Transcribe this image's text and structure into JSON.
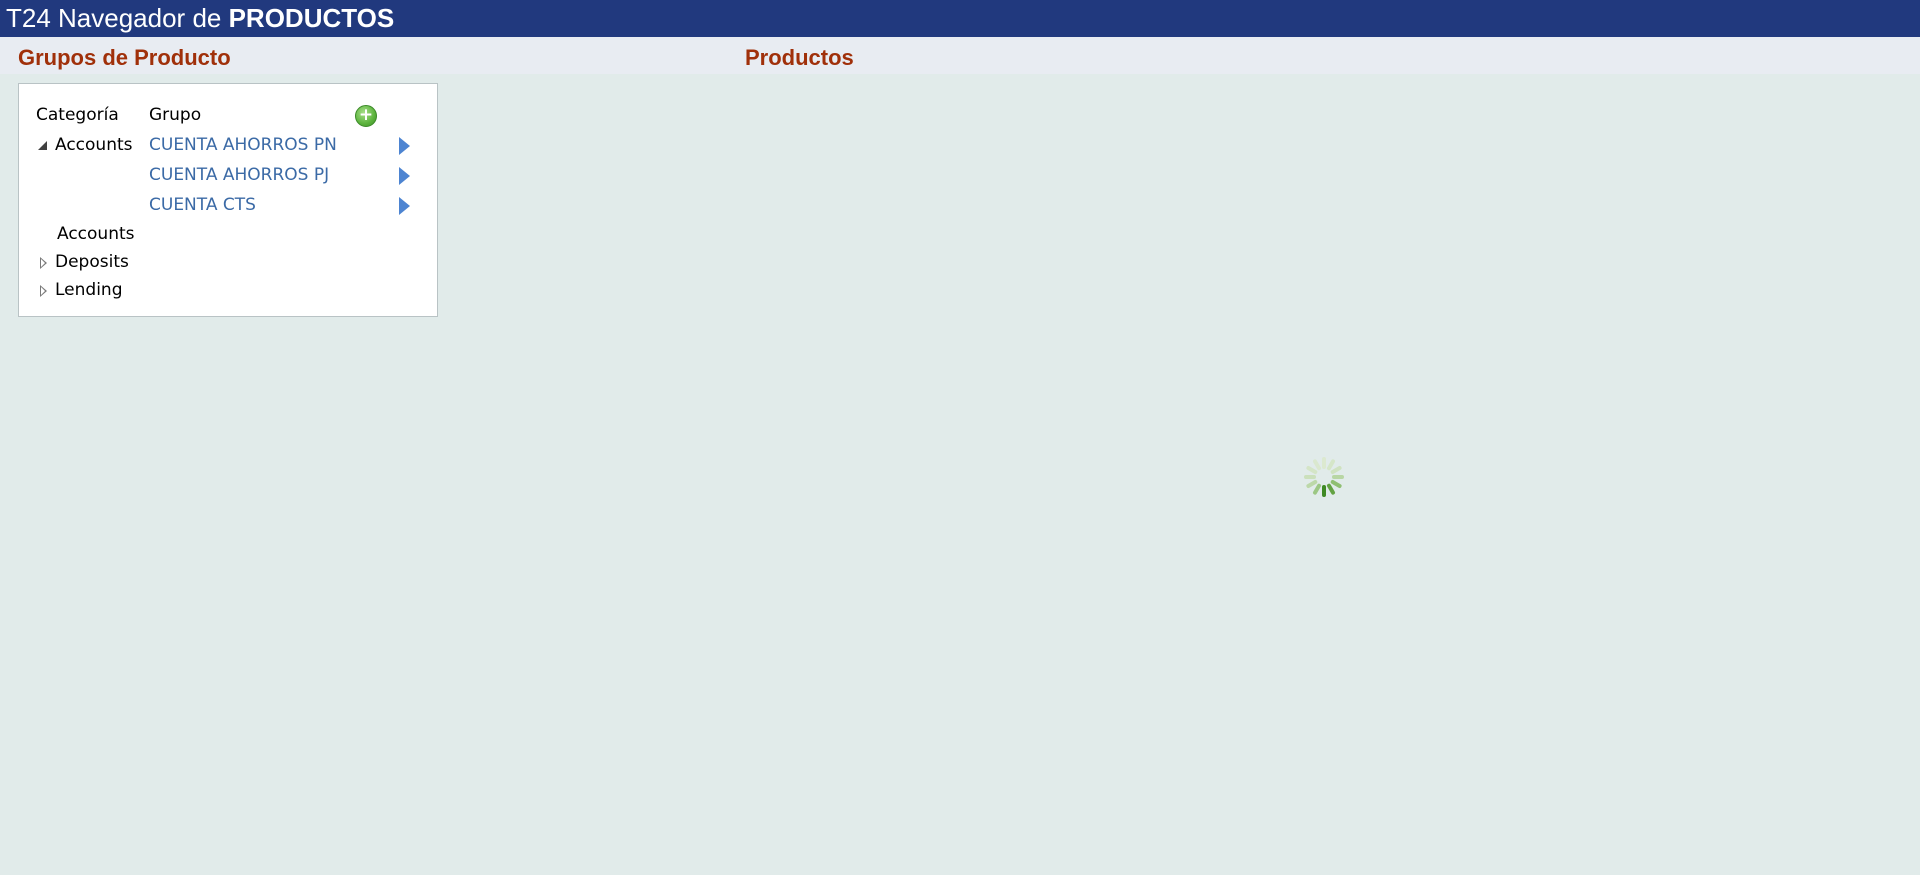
{
  "header": {
    "title_prefix": "T24 Navegador de ",
    "title_bold": "PRODUCTOS"
  },
  "sections": {
    "groups_title": "Grupos de Producto",
    "products_title": "Productos"
  },
  "groups_panel": {
    "col_category": "Categoría",
    "col_group": "Grupo",
    "add_icon": "add-circle-icon",
    "categories": [
      {
        "label": "Accounts",
        "expanded": true
      },
      {
        "label": "Deposits",
        "expanded": false
      },
      {
        "label": "Lending",
        "expanded": false
      }
    ],
    "groups": [
      {
        "label": "CUENTA AHORROS PN"
      },
      {
        "label": "CUENTA AHORROS PJ"
      },
      {
        "label": "CUENTA CTS"
      }
    ],
    "subcategory_label": "Accounts"
  },
  "products_panel": {
    "loading_icon": "loading-spinner-icon"
  },
  "colors": {
    "header_bg": "#21397e",
    "section_title": "#a0300a",
    "link": "#3b6aa6",
    "page_bg": "#e1ebea"
  }
}
